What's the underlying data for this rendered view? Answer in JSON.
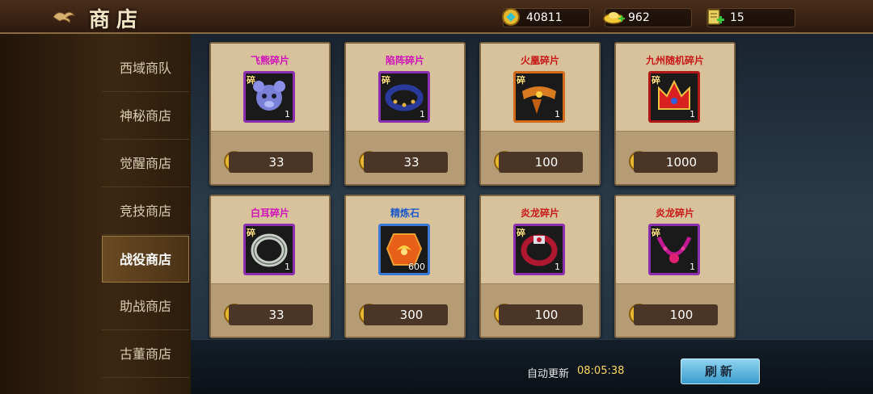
{
  "header": {
    "title": "商店",
    "gold": "40811",
    "ingot": "962",
    "stamina": "15"
  },
  "sidebar": {
    "items": [
      {
        "label": "西域商队"
      },
      {
        "label": "神秘商店"
      },
      {
        "label": "觉醒商店"
      },
      {
        "label": "竞技商店"
      },
      {
        "label": "战役商店"
      },
      {
        "label": "助战商店"
      },
      {
        "label": "古董商店"
      }
    ],
    "active_index": 4
  },
  "shop": {
    "items": [
      {
        "name": "飞熊碎片",
        "qty": "1",
        "price": "33",
        "name_color": "#d010b8",
        "frame": "purple",
        "icon": "bear-fragment-icon",
        "frag_mark": "碎"
      },
      {
        "name": "陷阵碎片",
        "qty": "1",
        "price": "33",
        "name_color": "#d010b8",
        "frame": "purple",
        "icon": "bracelet-fragment-icon",
        "frag_mark": "碎"
      },
      {
        "name": "火凰碎片",
        "qty": "1",
        "price": "100",
        "name_color": "#c81818",
        "frame": "orange",
        "icon": "phoenix-belt-fragment-icon",
        "frag_mark": "碎"
      },
      {
        "name": "九州随机碎片",
        "qty": "1",
        "price": "1000",
        "name_color": "#c81818",
        "frame": "red",
        "icon": "crown-fragment-icon",
        "frag_mark": "碎"
      },
      {
        "name": "白耳碎片",
        "qty": "1",
        "price": "33",
        "name_color": "#d010b8",
        "frame": "purple",
        "icon": "silver-ring-fragment-icon",
        "frag_mark": "碎"
      },
      {
        "name": "精炼石",
        "qty": "600",
        "price": "300",
        "name_color": "#1c5ac8",
        "frame": "blue",
        "icon": "refining-stone-icon",
        "frag_mark": ""
      },
      {
        "name": "炎龙碎片",
        "qty": "1",
        "price": "100",
        "name_color": "#c81818",
        "frame": "purple",
        "icon": "dragon-ring-fragment-icon",
        "frag_mark": "碎"
      },
      {
        "name": "炎龙碎片",
        "qty": "1",
        "price": "100",
        "name_color": "#c81818",
        "frame": "purple",
        "icon": "dragon-necklace-fragment-icon",
        "frag_mark": "碎"
      }
    ]
  },
  "footer": {
    "auto_refresh_label": "自动更新",
    "timer": "08:05:38",
    "refresh_label": "刷新"
  },
  "colors": {
    "accent_gold": "#ffd860",
    "refresh_button": "#3a9ccc"
  }
}
